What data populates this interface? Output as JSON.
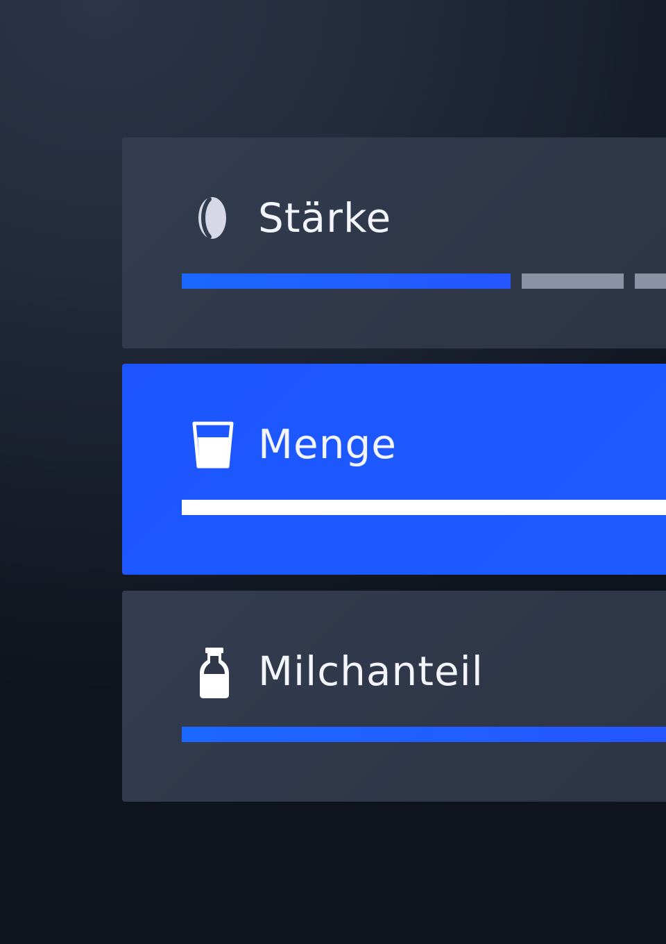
{
  "settings": [
    {
      "id": "staerke",
      "label": "Stärke",
      "icon": "coffee-bean-icon",
      "active": false,
      "level": 0.68
    },
    {
      "id": "menge",
      "label": "Menge",
      "icon": "glass-icon",
      "active": true,
      "level": 1.0
    },
    {
      "id": "milchanteil",
      "label": "Milchanteil",
      "icon": "milk-bottle-icon",
      "active": false,
      "level": 1.0
    }
  ],
  "colors": {
    "accent": "#1f5bff",
    "card_inactive": "#323a4c",
    "segment_inactive": "#8a92a5",
    "text": "#f3f5fa"
  }
}
